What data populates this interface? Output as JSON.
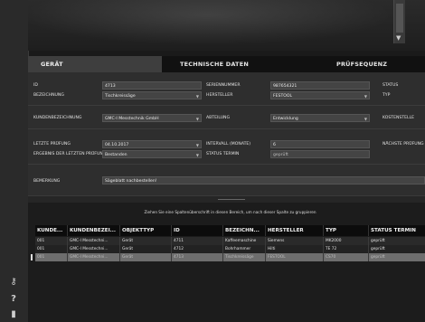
{
  "sidebar": {
    "icons": [
      {
        "name": "key-icon",
        "glyph": "⚷"
      },
      {
        "name": "help-icon",
        "glyph": "?"
      },
      {
        "name": "trash-icon",
        "glyph": "▮"
      }
    ]
  },
  "tabs": [
    {
      "label": "GERÄT",
      "active": true
    },
    {
      "label": "TECHNISCHE DATEN",
      "active": false
    },
    {
      "label": "PRÜFSEQUENZ",
      "active": false
    }
  ],
  "form": {
    "id": {
      "label": "ID",
      "value": "4713"
    },
    "bezeichnung": {
      "label": "BEZEICHNUNG",
      "value": "Tischkreissäge"
    },
    "seriennummer": {
      "label": "SERIENNUMMER",
      "value": "987654321"
    },
    "hersteller": {
      "label": "HERSTELLER",
      "value": "FESTOOL"
    },
    "status": {
      "label": "STATUS"
    },
    "typ": {
      "label": "TYP"
    },
    "kundenbezeichnung": {
      "label": "KUNDENBEZEICHNUNG",
      "value": "GMC-I Messtechnik GmbH"
    },
    "abteilung": {
      "label": "ABTEILUNG",
      "value": "Entwicklung"
    },
    "kostenstelle": {
      "label": "KOSTENSTELLE"
    },
    "letzte_pruefung": {
      "label": "LETZTE PRÜFUNG",
      "value": "04.10.2017"
    },
    "intervall": {
      "label": "INTERVALL (MONATE)",
      "value": "6"
    },
    "naechste_pruefung": {
      "label": "NÄCHSTE PRÜFUNG"
    },
    "ergebnis": {
      "label": "ERGEBNIS DER LETZTEN PRÜFUNG",
      "value": "Bestanden"
    },
    "status_termin": {
      "label": "STATUS TERMIN",
      "value": "geprüft"
    },
    "bemerkung": {
      "label": "BEMERKUNG",
      "value": "Sägeblatt nachbestellen!"
    }
  },
  "grid": {
    "group_hint": "Ziehen Sie eine Spaltenüberschrift in diesen Bereich, um nach dieser Spalte zu gruppieren",
    "columns": [
      "KUNDE...",
      "KUNDENBEZEI...",
      "OBJEKTTYP",
      "ID",
      "BEZEICHN...",
      "HERSTELLER",
      "TYP",
      "STATUS TERMIN"
    ],
    "rows": [
      [
        "001",
        "GMC-I Messtechni...",
        "Gerät",
        "4711",
        "Kaffeemaschine",
        "Siemens",
        "MK2000",
        "geprüft"
      ],
      [
        "001",
        "GMC-I Messtechni...",
        "Gerät",
        "4712",
        "Bohrhammer",
        "Hilti",
        "TE 72",
        "geprüft"
      ],
      [
        "001",
        "GMC-I Messtechni...",
        "Gerät",
        "4713",
        "Tischkreissäge",
        "FESTOOL",
        "CS70",
        "geprüft"
      ]
    ],
    "selected_row": 2
  }
}
